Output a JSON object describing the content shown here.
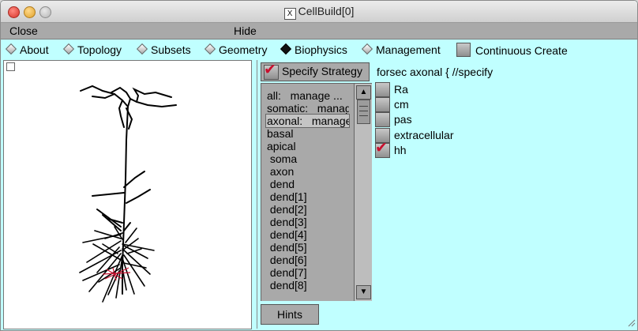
{
  "window": {
    "title": "CellBuild[0]"
  },
  "menubar": {
    "close": "Close",
    "hide": "Hide"
  },
  "toolbar": {
    "radios": [
      {
        "label": "About",
        "selected": false
      },
      {
        "label": "Topology",
        "selected": false
      },
      {
        "label": "Subsets",
        "selected": false
      },
      {
        "label": "Geometry",
        "selected": false
      },
      {
        "label": "Biophysics",
        "selected": true
      },
      {
        "label": "Management",
        "selected": false
      }
    ],
    "continuous_create": {
      "label": "Continuous Create",
      "checked": false
    }
  },
  "strategy": {
    "specify_label": "Specify Strategy",
    "specify_checked": true,
    "items": [
      "all:   manage ...",
      "somatic:   manage",
      "axonal:   manage",
      "basal",
      "apical",
      " soma",
      " axon",
      " dend",
      " dend[1]",
      " dend[2]",
      " dend[3]",
      " dend[4]",
      " dend[5]",
      " dend[6]",
      " dend[7]",
      " dend[8]"
    ],
    "selected_index": 2,
    "hints_label": "Hints"
  },
  "mechanisms": {
    "title": "forsec axonal { //specify",
    "items": [
      {
        "label": "Ra",
        "checked": false
      },
      {
        "label": "cm",
        "checked": false
      },
      {
        "label": "pas",
        "checked": false
      },
      {
        "label": "extracellular",
        "checked": false
      },
      {
        "label": "hh",
        "checked": true
      }
    ]
  },
  "colors": {
    "panel_bg": "#c0ffff",
    "control_gray": "#a9a9a9",
    "check_red": "#c8102e"
  }
}
